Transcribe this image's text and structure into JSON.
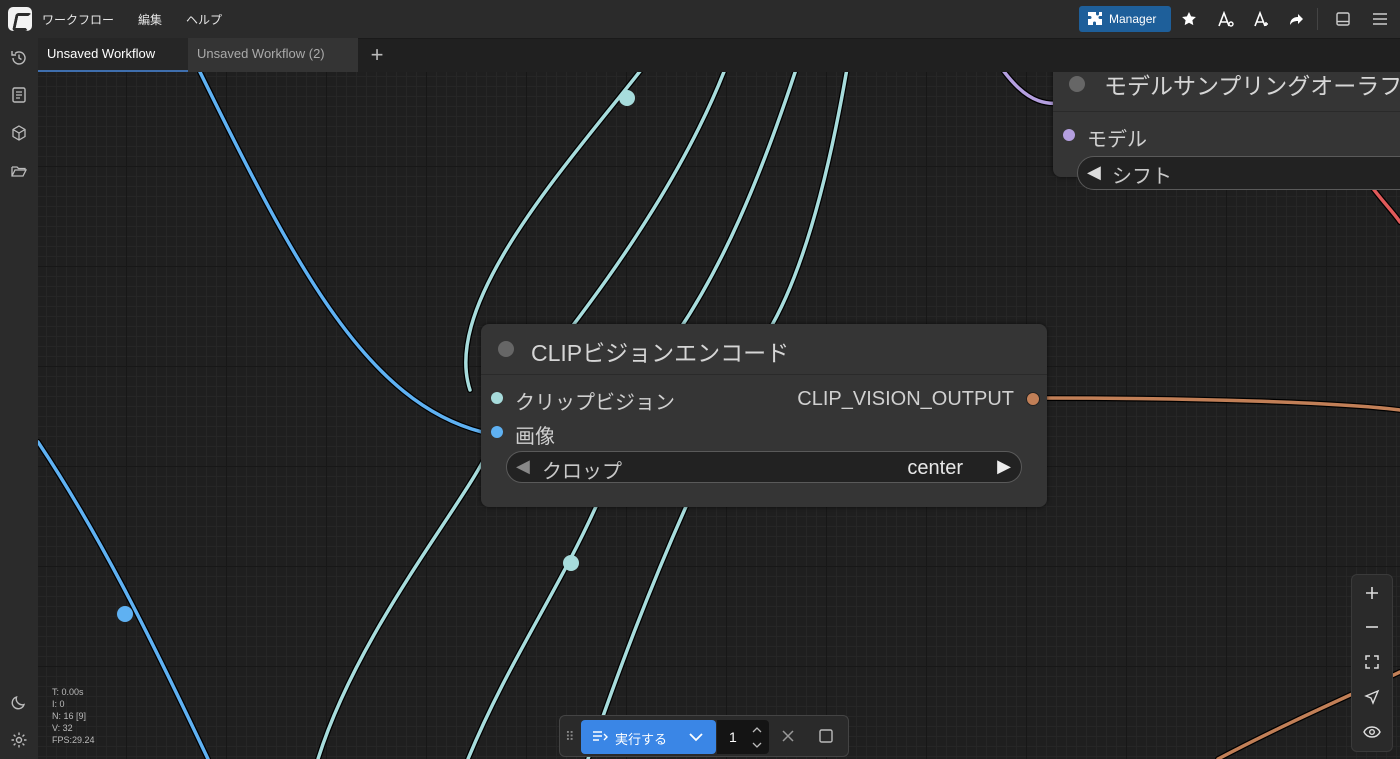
{
  "menu": {
    "workflow": "ワークフロー",
    "edit": "編集",
    "help": "ヘルプ"
  },
  "topbar": {
    "manager_label": "Manager"
  },
  "tabs": [
    {
      "label": "Unsaved Workflow"
    },
    {
      "label": "Unsaved Workflow (2)"
    }
  ],
  "node_clip": {
    "title": "CLIPビジョンエンコード",
    "input_clip_vision": "クリップビジョン",
    "input_image": "画像",
    "output": "CLIP_VISION_OUTPUT",
    "crop_label": "クロップ",
    "crop_value": "center"
  },
  "node_model": {
    "title": "モデルサンプリングオーラフ",
    "input_model": "モデル",
    "shift_label": "シフト"
  },
  "stats": {
    "t": "T: 0.00s",
    "i": "I: 0",
    "n": "N: 16 [9]",
    "v": "V: 32",
    "fps": "FPS:29.24"
  },
  "runbar": {
    "run_label": "実行する",
    "quantity": "1"
  },
  "colors": {
    "clip_vision_link": "#a7dcdc",
    "image_link": "#5fb1f2",
    "model_link": "#b49fdf",
    "clip_output_link": "#c17f57",
    "accent": "#3a86e6"
  }
}
